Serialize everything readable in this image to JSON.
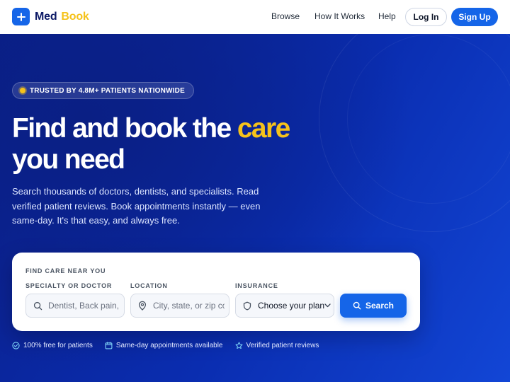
{
  "brand": {
    "name_part1": "Med",
    "name_part2": "Book",
    "accent": "#1565e8",
    "highlight": "#f5c21b"
  },
  "nav": {
    "links": [
      "Browse",
      "How It Works",
      "Help"
    ],
    "login_label": "Log In",
    "signup_label": "Sign Up"
  },
  "hero": {
    "badge": "TRUSTED BY 4.8M+ PATIENTS NATIONWIDE",
    "headline_before": "Find and book the ",
    "headline_highlight": "care",
    "headline_after": "you need",
    "subtext": "Search thousands of doctors, dentists, and specialists. Read verified patient reviews. Book appointments instantly — even same-day. It's that easy, and always free."
  },
  "search": {
    "title": "FIND CARE NEAR YOU",
    "specialty_label": "SPECIALTY OR DOCTOR",
    "specialty_placeholder": "Dentist, Back pain, Dr. Smith",
    "location_label": "LOCATION",
    "location_placeholder": "City, state, or zip code",
    "insurance_label": "INSURANCE",
    "insurance_value": "Choose your plan",
    "button_label": "Search"
  },
  "perks": [
    {
      "icon": "check-circle-icon",
      "text": "100% free for patients"
    },
    {
      "icon": "calendar-icon",
      "text": "Same-day appointments available"
    },
    {
      "icon": "star-icon",
      "text": "Verified patient reviews"
    }
  ],
  "icons": {
    "logo": "plus-icon",
    "specialty": "search-icon",
    "location": "map-pin-icon",
    "insurance": "shield-icon",
    "insurance_caret": "chevron-down-icon",
    "search_button": "search-icon"
  }
}
